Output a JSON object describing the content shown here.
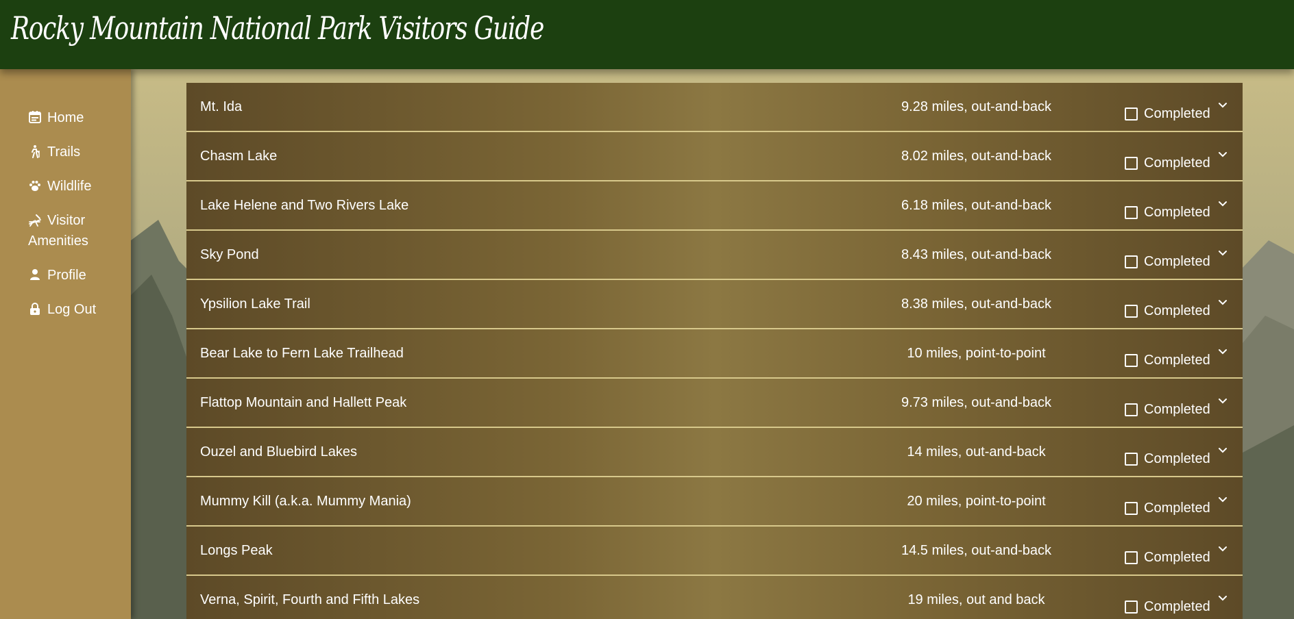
{
  "header": {
    "title": "Rocky Mountain National Park Visitors Guide"
  },
  "sidebar": {
    "items": [
      {
        "label": "Home",
        "icon": "calendar-icon"
      },
      {
        "label": "Trails",
        "icon": "hiker-icon"
      },
      {
        "label": "Wildlife",
        "icon": "paw-icon"
      },
      {
        "label": "Visitor Amenities",
        "icon": "picnic-icon"
      },
      {
        "label": "Profile",
        "icon": "user-icon"
      },
      {
        "label": "Log Out",
        "icon": "lock-icon"
      }
    ]
  },
  "trails": {
    "completed_label": "Completed",
    "rows": [
      {
        "name": "Mt. Ida",
        "distance": "9.28 miles, out-and-back",
        "completed": false
      },
      {
        "name": "Chasm Lake",
        "distance": "8.02 miles, out-and-back",
        "completed": false
      },
      {
        "name": "Lake Helene and Two Rivers Lake",
        "distance": "6.18 miles, out-and-back",
        "completed": false
      },
      {
        "name": "Sky Pond",
        "distance": "8.43 miles, out-and-back",
        "completed": false
      },
      {
        "name": "Ypsilion Lake Trail",
        "distance": "8.38 miles, out-and-back",
        "completed": false
      },
      {
        "name": "Bear Lake to Fern Lake Trailhead",
        "distance": "10 miles, point-to-point",
        "completed": false
      },
      {
        "name": "Flattop Mountain and Hallett Peak",
        "distance": "9.73 miles, out-and-back",
        "completed": false
      },
      {
        "name": "Ouzel and Bluebird Lakes",
        "distance": "14 miles, out-and-back",
        "completed": false
      },
      {
        "name": "Mummy Kill (a.k.a. Mummy Mania)",
        "distance": "20 miles, point-to-point",
        "completed": false
      },
      {
        "name": "Longs Peak",
        "distance": "14.5 miles, out-and-back",
        "completed": false
      },
      {
        "name": "Verna, Spirit, Fourth and Fifth Lakes",
        "distance": "19 miles, out and back",
        "completed": false
      }
    ]
  },
  "colors": {
    "header_bg": "#1c4010",
    "sidebar_bg": "#ab8c4f",
    "row_bg": "#7a6535",
    "row_border": "#d8c98c"
  }
}
